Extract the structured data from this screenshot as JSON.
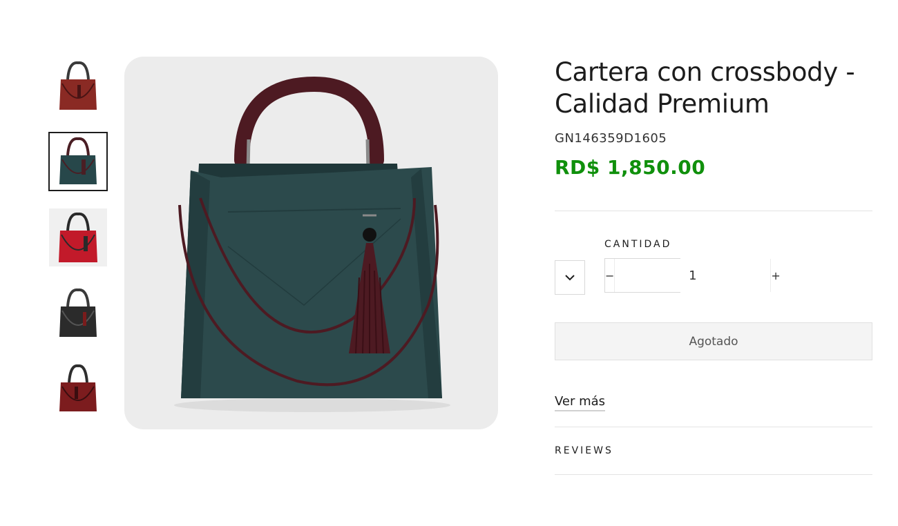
{
  "product": {
    "title": "Cartera con crossbody - Calidad Premium",
    "sku": "GN146359D1605",
    "price": "RD$ 1,850.00",
    "price_color": "#10900c"
  },
  "gallery": {
    "selected_index": 1,
    "thumbnails": [
      {
        "color": "#8a2a24",
        "handle": "#3a3a3a"
      },
      {
        "color": "#27474a",
        "handle": "#4a1e24"
      },
      {
        "color": "#c21a2a",
        "handle": "#2a2a2a"
      },
      {
        "color": "#2b2b2b",
        "handle": "#3a3a3a"
      },
      {
        "color": "#7c1c1e",
        "handle": "#2e2e2e"
      }
    ],
    "main_bag_color": "#2c4a4c",
    "main_trim_color": "#4d1a22"
  },
  "variant_select": {
    "icon": "chevron-down-icon"
  },
  "quantity": {
    "label": "CANTIDAD",
    "value": "1",
    "decrement": "−",
    "increment": "+"
  },
  "add_to_cart": {
    "label": "Agotado"
  },
  "links": {
    "ver_mas": "Ver más"
  },
  "reviews": {
    "label": "REVIEWS"
  }
}
